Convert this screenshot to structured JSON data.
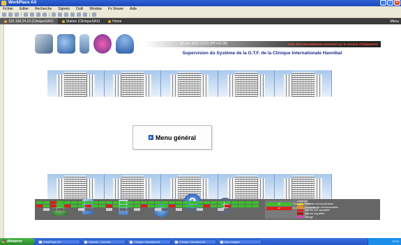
{
  "window": {
    "title": "WorkPlace AX"
  },
  "menubar": {
    "items": [
      "Fichier",
      "Editer",
      "Recherche",
      "Signets",
      "Outil",
      "Window",
      "Fx Viewer",
      "Aide"
    ]
  },
  "tabs": [
    {
      "label": "192.168.24.10 (CliniqueSAX)",
      "active": true
    },
    {
      "label": "Station (CliniqueSAX)",
      "active": false
    },
    {
      "label": "Home",
      "active": false
    }
  ],
  "tab_right": "Menu",
  "banner": {
    "date": "22 oct. 2013 13:23 (HT+01:00)",
    "connection": "Vous êtes actuellement connecté sur le serveur CliniqueSAX",
    "supervision_title": "Supervision du Système de la G.T.F. de la Clinique Internationale Hannibal"
  },
  "main_menu_label": "Menu général",
  "panel": {
    "status_labels": [
      "Alarmes en cours",
      "Alarmes non acquittées"
    ],
    "status_values": [
      "32",
      "12"
    ],
    "legend_title": "Legende:",
    "legend": [
      {
        "label": "Perte de communication",
        "color": "#e8d020"
      },
      {
        "label": "Problème de communication",
        "color": "#f09020"
      },
      {
        "label": "Alarme non acquittée",
        "color": "#e02020"
      },
      {
        "label": "Alarme acquittée",
        "color": "#b01818"
      },
      {
        "label": "Délogé",
        "color": "#e040c0"
      }
    ]
  },
  "taskbar": {
    "start": "démarrer",
    "tasks": [
      "WorkPlace AX",
      "Hotmail - Courrier...",
      "Clinique Hannibal AX",
      "Clinique Hannibal AX",
      "Mes images"
    ],
    "clock": "13:23"
  },
  "colors": {
    "title_blue": "#1a2a8a",
    "alarm_red": "#d8201a",
    "ok_green": "#3cbf2a"
  }
}
